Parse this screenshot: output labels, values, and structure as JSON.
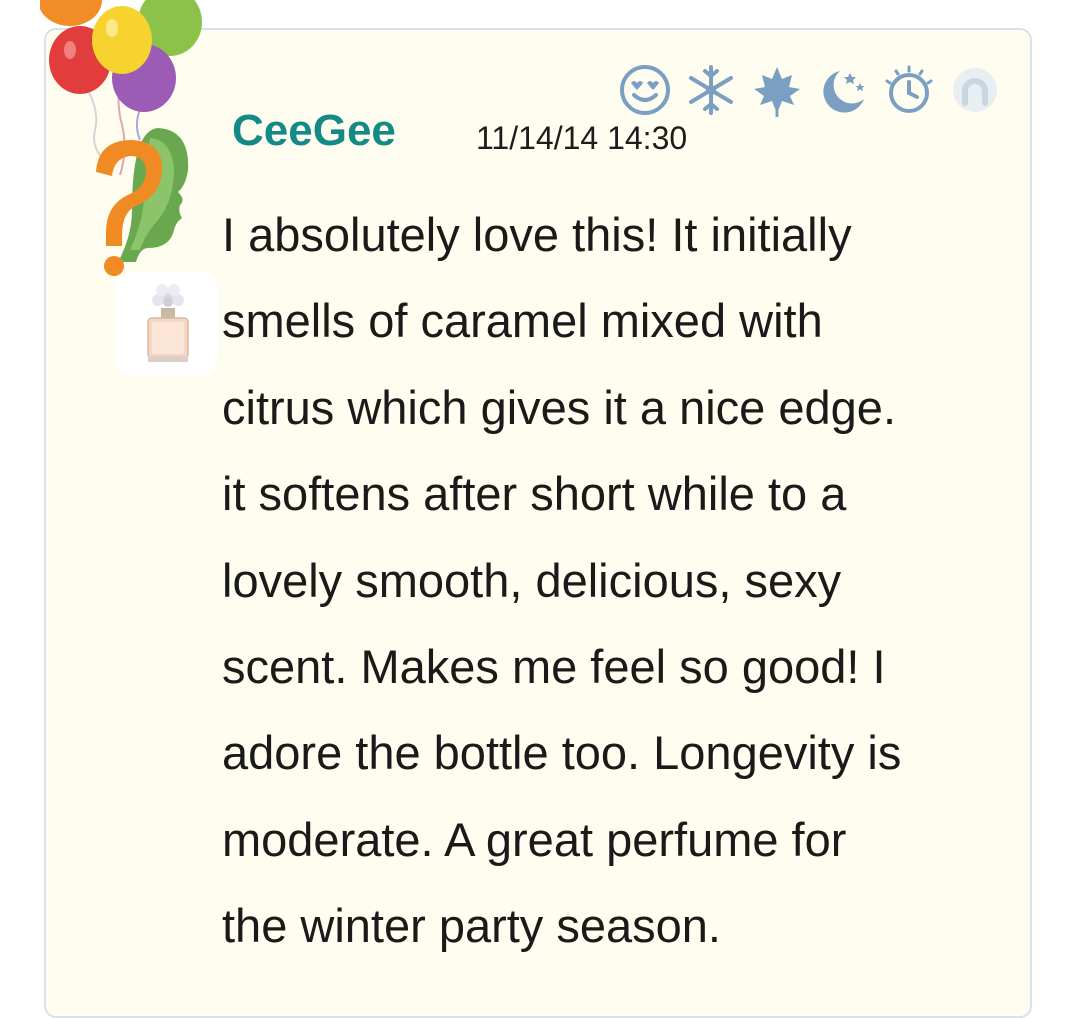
{
  "review": {
    "username": "CeeGee",
    "timestamp": "11/14/14 14:30",
    "text": "I absolutely love this! It initially\nsmells of caramel mixed with\ncitrus which gives it a nice edge.\nit softens after short while to a\nlovely smooth, delicious, sexy\nscent. Makes me feel so good! I\nadore the bottle too. Longevity is\nmoderate. A great perfume for\nthe winter party season."
  },
  "icons": [
    "love-rating-icon",
    "winter-icon",
    "fall-icon",
    "night-icon",
    "day-icon",
    "spring-icon"
  ],
  "colors": {
    "username": "#138a85",
    "card_background": "#fffdef",
    "card_border": "#d6e2ea",
    "icon_active": "#7b9fc2",
    "icon_inactive": "#c9d6df"
  }
}
